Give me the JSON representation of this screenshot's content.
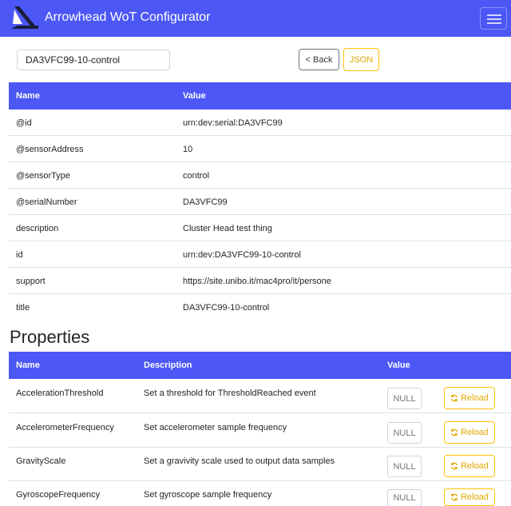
{
  "app": {
    "title": "Arrowhead WoT Configurator"
  },
  "toolbar": {
    "thing_name": "DA3VFC99-10-control",
    "back_label": "< Back",
    "json_label": "JSON"
  },
  "info_table": {
    "headers": [
      "Name",
      "Value"
    ],
    "rows": [
      {
        "name": "@id",
        "value": "urn:dev:serial:DA3VFC99"
      },
      {
        "name": "@sensorAddress",
        "value": "10"
      },
      {
        "name": "@sensorType",
        "value": "control"
      },
      {
        "name": "@serialNumber",
        "value": "DA3VFC99"
      },
      {
        "name": "description",
        "value": "Cluster Head test thing"
      },
      {
        "name": "id",
        "value": "urn:dev:DA3VFC99-10-control"
      },
      {
        "name": "support",
        "value": "https://site.unibo.it/mac4pro/it/persone"
      },
      {
        "name": "title",
        "value": "DA3VFC99-10-control"
      }
    ]
  },
  "properties": {
    "title": "Properties",
    "headers": [
      "Name",
      "Description",
      "Value"
    ],
    "rows": [
      {
        "name": "AccelerationThreshold",
        "description": "Set a threshold for ThresholdReached event",
        "value": "NULL",
        "reload": "Reload"
      },
      {
        "name": "AccelerometerFrequency",
        "description": "Set accelerometer sample frequency",
        "value": "NULL",
        "reload": "Reload"
      },
      {
        "name": "GravityScale",
        "description": "Set a gravivity scale used to output data samples",
        "value": "NULL",
        "reload": "Reload"
      },
      {
        "name": "GyroscopeFrequency",
        "description": "Set gyroscope sample frequency",
        "value": "NULL",
        "reload": "Reload"
      }
    ]
  },
  "colors": {
    "primary": "#4c57f5",
    "warning": "#ffc107",
    "border": "#dee2e6"
  },
  "icons": {
    "brand": "arrowhead-logo-icon",
    "menu": "hamburger-menu-icon",
    "reload": "refresh-icon"
  }
}
